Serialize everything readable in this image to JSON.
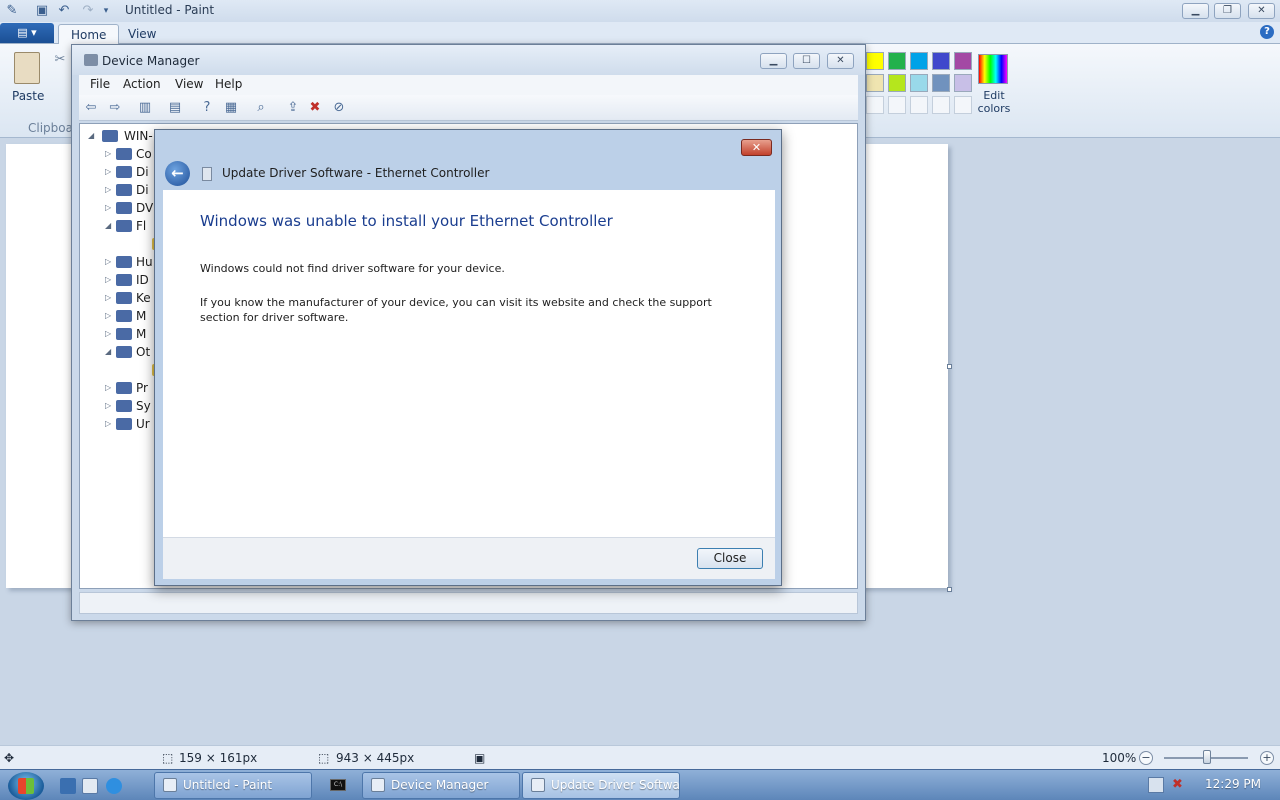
{
  "paint": {
    "title": "Untitled - Paint",
    "tabs": [
      {
        "label": "Home"
      },
      {
        "label": "View"
      }
    ],
    "paste_label": "Paste",
    "clipboard_label": "Clipboar",
    "edit_colors_label": "Edit colors",
    "palette_colors": [
      "#ffff00",
      "#22b14c",
      "#00a2e8",
      "#3f48cc",
      "#a349a4",
      "#efe4b0",
      "#b5e61d",
      "#99d9ea",
      "#7092be",
      "#c8bfe7"
    ],
    "status": {
      "selection_size": "159 × 161px",
      "canvas_size": "943 × 445px",
      "zoom": "100%"
    }
  },
  "device_manager": {
    "title": "Device Manager",
    "menu": [
      {
        "label": "File"
      },
      {
        "label": "Action"
      },
      {
        "label": "View"
      },
      {
        "label": "Help"
      }
    ],
    "tree": {
      "root": "WIN-",
      "items": [
        {
          "label": "Co",
          "expander": "▷"
        },
        {
          "label": "Di",
          "expander": "▷"
        },
        {
          "label": "Di",
          "expander": "▷"
        },
        {
          "label": "DV",
          "expander": "▷"
        },
        {
          "label": "Fl",
          "expander": "◢"
        },
        {
          "label": "",
          "expander": ""
        },
        {
          "label": "Hu",
          "expander": "▷"
        },
        {
          "label": "ID",
          "expander": "▷"
        },
        {
          "label": "Ke",
          "expander": "▷"
        },
        {
          "label": "M",
          "expander": "▷"
        },
        {
          "label": "M",
          "expander": "▷"
        },
        {
          "label": "Ot",
          "expander": "◢"
        },
        {
          "label": "",
          "expander": ""
        },
        {
          "label": "Pr",
          "expander": "▷"
        },
        {
          "label": "Sy",
          "expander": "▷"
        },
        {
          "label": "Ur",
          "expander": "▷"
        }
      ]
    }
  },
  "update_driver": {
    "title": "Update Driver Software - Ethernet Controller",
    "heading": "Windows was unable to install your Ethernet Controller",
    "message1": "Windows could not find driver software for your device.",
    "message2": "If you know the manufacturer of your device, you can visit its website and check the support section for driver software.",
    "close_label": "Close"
  },
  "taskbar": {
    "buttons": [
      {
        "label": "Untitled - Paint"
      },
      {
        "label": "Device Manager"
      },
      {
        "label": "Update Driver Softwa..."
      }
    ],
    "clock": "12:29 PM"
  }
}
